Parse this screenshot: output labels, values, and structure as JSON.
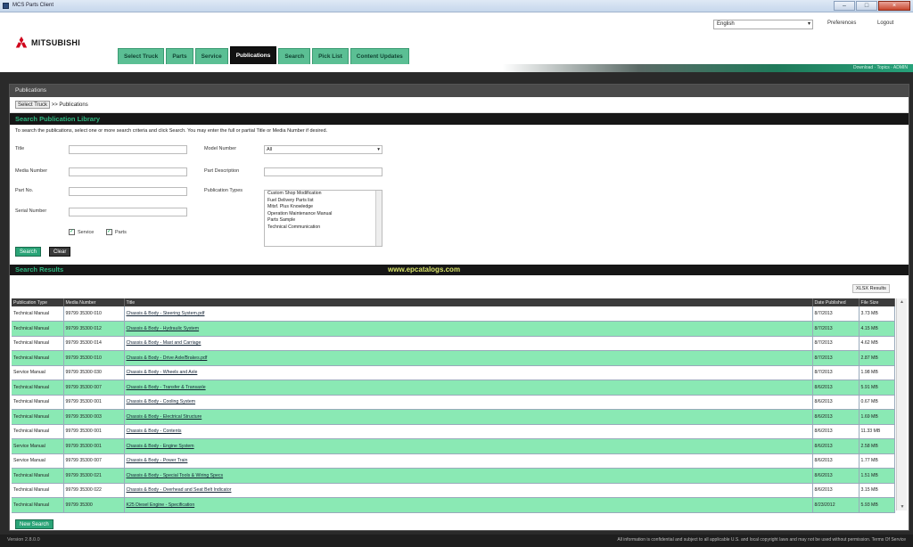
{
  "window": {
    "title": "MCS Parts Client"
  },
  "header": {
    "brand": "MITSUBISHI",
    "language": "English",
    "links": [
      "Preferences",
      "Logout"
    ],
    "tabs": [
      "Select Truck",
      "Parts",
      "Service",
      "Publications",
      "Search",
      "Pick List",
      "Content Updates"
    ],
    "active_tab": "Publications",
    "tools_text": "Download · Topics · ADMIN"
  },
  "panel": {
    "title": "Publications",
    "breadcrumb": {
      "home": "Select Truck",
      "current": "Publications"
    },
    "search_section_title": "Search Publication Library",
    "instructions": "To search the publications, select one or more search criteria and click Search. You may enter the full or partial Title or Media Number if desired.",
    "form": {
      "title_label": "Title",
      "media_label": "Media Number",
      "partno_label": "Part No.",
      "serial_label": "Serial Number",
      "model_label": "Model Number",
      "model_value": "All",
      "partdesc_label": "Part Description",
      "pubtype_label": "Publication Types",
      "pubtypes": [
        "Custom Shop Modification",
        "Fuel Delivery Parts list",
        "Mitsf. Plus Knowledge",
        "Operation Maintenance Manual",
        "Parts Sample",
        "Technical Communication"
      ],
      "check_service": "Service",
      "check_parts": "Parts",
      "search_btn": "Search",
      "clear_btn": "Clear"
    },
    "results_title": "Search Results",
    "watermark": "www.epcatalogs.com",
    "export_btn": "XLSX Results",
    "columns": [
      "Publication Type",
      "Media Number",
      "Title",
      "Date Published",
      "File Size"
    ],
    "rows": [
      [
        "Technical Manual",
        "99799 35300 010",
        "Chassis & Body - Steering System.pdf",
        "8/7/2013",
        "3.73 MB"
      ],
      [
        "Technical Manual",
        "99799 35300 012",
        "Chassis & Body - Hydraulic System",
        "8/7/2013",
        "4.15 MB"
      ],
      [
        "Technical Manual",
        "99799 35300 014",
        "Chassis & Body - Mast and Carriage",
        "8/7/2013",
        "4.62 MB"
      ],
      [
        "Technical Manual",
        "99799 35300 010",
        "Chassis & Body - Drive Axle/Brakes.pdf",
        "8/7/2013",
        "2.87 MB"
      ],
      [
        "Service Manual",
        "99799 35300 030",
        "Chassis & Body - Wheels and Axle",
        "8/7/2013",
        "1.98 MB"
      ],
      [
        "Technical Manual",
        "99799 35300 007",
        "Chassis & Body - Transfer & Transaxle",
        "8/6/2013",
        "5.91 MB"
      ],
      [
        "Technical Manual",
        "99799 35300 001",
        "Chassis & Body - Cooling System",
        "8/6/2013",
        "0.67 MB"
      ],
      [
        "Technical Manual",
        "99799 35300 003",
        "Chassis & Body - Electrical Structure",
        "8/6/2013",
        "1.69 MB"
      ],
      [
        "Technical Manual",
        "99799 35300 001",
        "Chassis & Body - Contents",
        "8/6/2013",
        "11.33 MB"
      ],
      [
        "Service Manual",
        "99799 35300 001",
        "Chassis & Body - Engine System",
        "8/6/2013",
        "2.58 MB"
      ],
      [
        "Service Manual",
        "99799 35300 007",
        "Chassis & Body - Power Train",
        "8/6/2013",
        "1.77 MB"
      ],
      [
        "Technical Manual",
        "99799 35300 021",
        "Chassis & Body - Special Tools & Wiring Specs",
        "8/6/2013",
        "1.51 MB"
      ],
      [
        "Technical Manual",
        "99799 35300 022",
        "Chassis & Body - Overhead and Seat Belt Indicator",
        "8/6/2013",
        "3.15 MB"
      ],
      [
        "Technical Manual",
        "99799 35300",
        "K25 Diesel Engine - Specification",
        "8/23/2012",
        "5.93 MB"
      ]
    ],
    "new_search_btn": "New Search"
  },
  "footer": {
    "version": "Version 2.8.0.0",
    "copyright": "All information is confidential and subject to all applicable U.S. and local copyright laws and may not be used without permission. Terms Of Service"
  }
}
